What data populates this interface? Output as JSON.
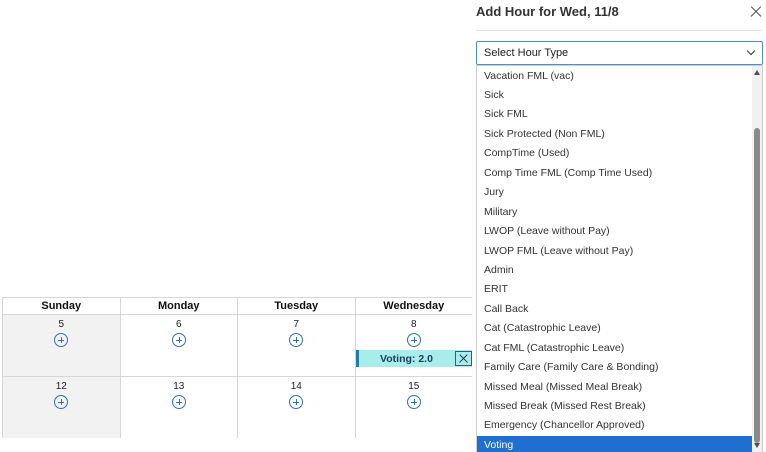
{
  "calendar": {
    "headers": [
      "Sunday",
      "Monday",
      "Tuesday",
      "Wednesday"
    ],
    "weeks": [
      {
        "days": [
          "5",
          "6",
          "7",
          "8"
        ]
      },
      {
        "days": [
          "12",
          "13",
          "14",
          "15"
        ]
      }
    ],
    "entry": {
      "label": "Voting: 2.0"
    }
  },
  "panel": {
    "title": "Add Hour for Wed, 11/8",
    "select": {
      "label": "Select Hour Type"
    },
    "options": [
      "Vacation FML (vac)",
      "Sick",
      "Sick FML",
      "Sick Protected (Non FML)",
      "CompTime (Used)",
      "Comp Time FML (Comp Time Used)",
      "Jury",
      "Military",
      "LWOP (Leave without Pay)",
      "LWOP FML (Leave without Pay)",
      "Admin",
      "ERIT",
      "Call Back",
      "Cat (Catastrophic Leave)",
      "Cat FML (Catastrophic Leave)",
      "Family Care (Family Care & Bonding)",
      "Missed Meal (Missed Meal Break)",
      "Missed Break (Missed Rest Break)",
      "Emergency (Chancellor Approved)",
      "Voting"
    ],
    "selected_option": "Voting"
  },
  "colors": {
    "accent": "#1f6fd1",
    "entry_bg": "#a8ecec",
    "entry_border": "#1f7ea8",
    "add_icon": "#2f6fbf"
  },
  "icons": {
    "add": "plus-circle-icon",
    "close": "close-icon",
    "chevron": "chevron-down-icon"
  }
}
